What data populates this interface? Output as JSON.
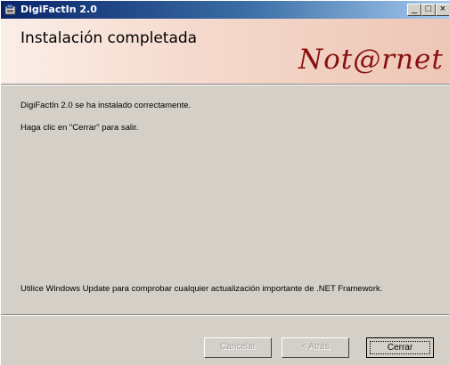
{
  "window": {
    "title": "DigiFactIn 2.0",
    "icon": "installer-icon",
    "controls": {
      "minimize": "_",
      "maximize": "□",
      "close": "×"
    }
  },
  "header": {
    "title": "Instalación completada",
    "logo_text": "Not@rnet",
    "logo_color": "#8a1010"
  },
  "content": {
    "line1": "DigiFactIn 2.0 se ha instalado correctamente.",
    "line2": "Haga clic en \"Cerrar\" para salir.",
    "line3": "Utilice Windows Update para comprobar cualquier actualización importante de .NET Framework."
  },
  "buttons": {
    "cancel": "Cancelar",
    "back": "< Atrás",
    "close": "Cerrar"
  }
}
